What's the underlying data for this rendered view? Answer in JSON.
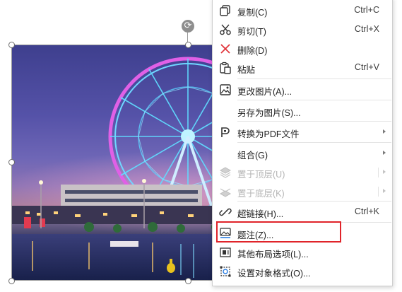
{
  "picture": {
    "description_icon": "ferris-wheel-photo",
    "colors": {
      "sky_top": "#3e3f8e",
      "sky_glow": "#b07f98",
      "wheel_neon": "#55d8ff",
      "wheel_rim": "#e05fe0",
      "water": "#1f2a55"
    }
  },
  "rotate_handle": {
    "icon": "rotate-icon",
    "glyph": "⟳"
  },
  "menu": {
    "items": [
      {
        "icon": "copy-icon",
        "label": "复制(C)",
        "shortcut": "Ctrl+C",
        "enabled": true
      },
      {
        "icon": "cut-icon",
        "label": "剪切(T)",
        "shortcut": "Ctrl+X",
        "enabled": true
      },
      {
        "icon": "delete-icon",
        "label": "删除(D)",
        "shortcut": "",
        "enabled": true
      },
      {
        "icon": "paste-icon",
        "label": "粘贴",
        "shortcut": "Ctrl+V",
        "enabled": true
      },
      {
        "icon": "change-picture-icon",
        "label": "更改图片(A)...",
        "shortcut": "",
        "enabled": true
      },
      {
        "icon": "",
        "label": "另存为图片(S)...",
        "shortcut": "",
        "enabled": true
      },
      {
        "icon": "convert-pdf-icon",
        "label": "转换为PDF文件",
        "shortcut": "",
        "enabled": true,
        "submenu": true
      },
      {
        "icon": "",
        "label": "组合(G)",
        "shortcut": "",
        "enabled": true,
        "submenu": true
      },
      {
        "icon": "bring-to-front-icon",
        "label": "置于顶层(U)",
        "shortcut": "",
        "enabled": false,
        "submenu": true
      },
      {
        "icon": "send-to-back-icon",
        "label": "置于底层(K)",
        "shortcut": "",
        "enabled": false,
        "submenu": true
      },
      {
        "icon": "hyperlink-icon",
        "label": "超链接(H)...",
        "shortcut": "Ctrl+K",
        "enabled": true
      },
      {
        "icon": "caption-icon",
        "label": "题注(Z)...",
        "shortcut": "",
        "enabled": true,
        "highlighted": true
      },
      {
        "icon": "layout-options-icon",
        "label": "其他布局选项(L)...",
        "shortcut": "",
        "enabled": true
      },
      {
        "icon": "format-object-icon",
        "label": "设置对象格式(O)...",
        "shortcut": "",
        "enabled": true
      }
    ]
  },
  "highlight_color": "#e0242a"
}
